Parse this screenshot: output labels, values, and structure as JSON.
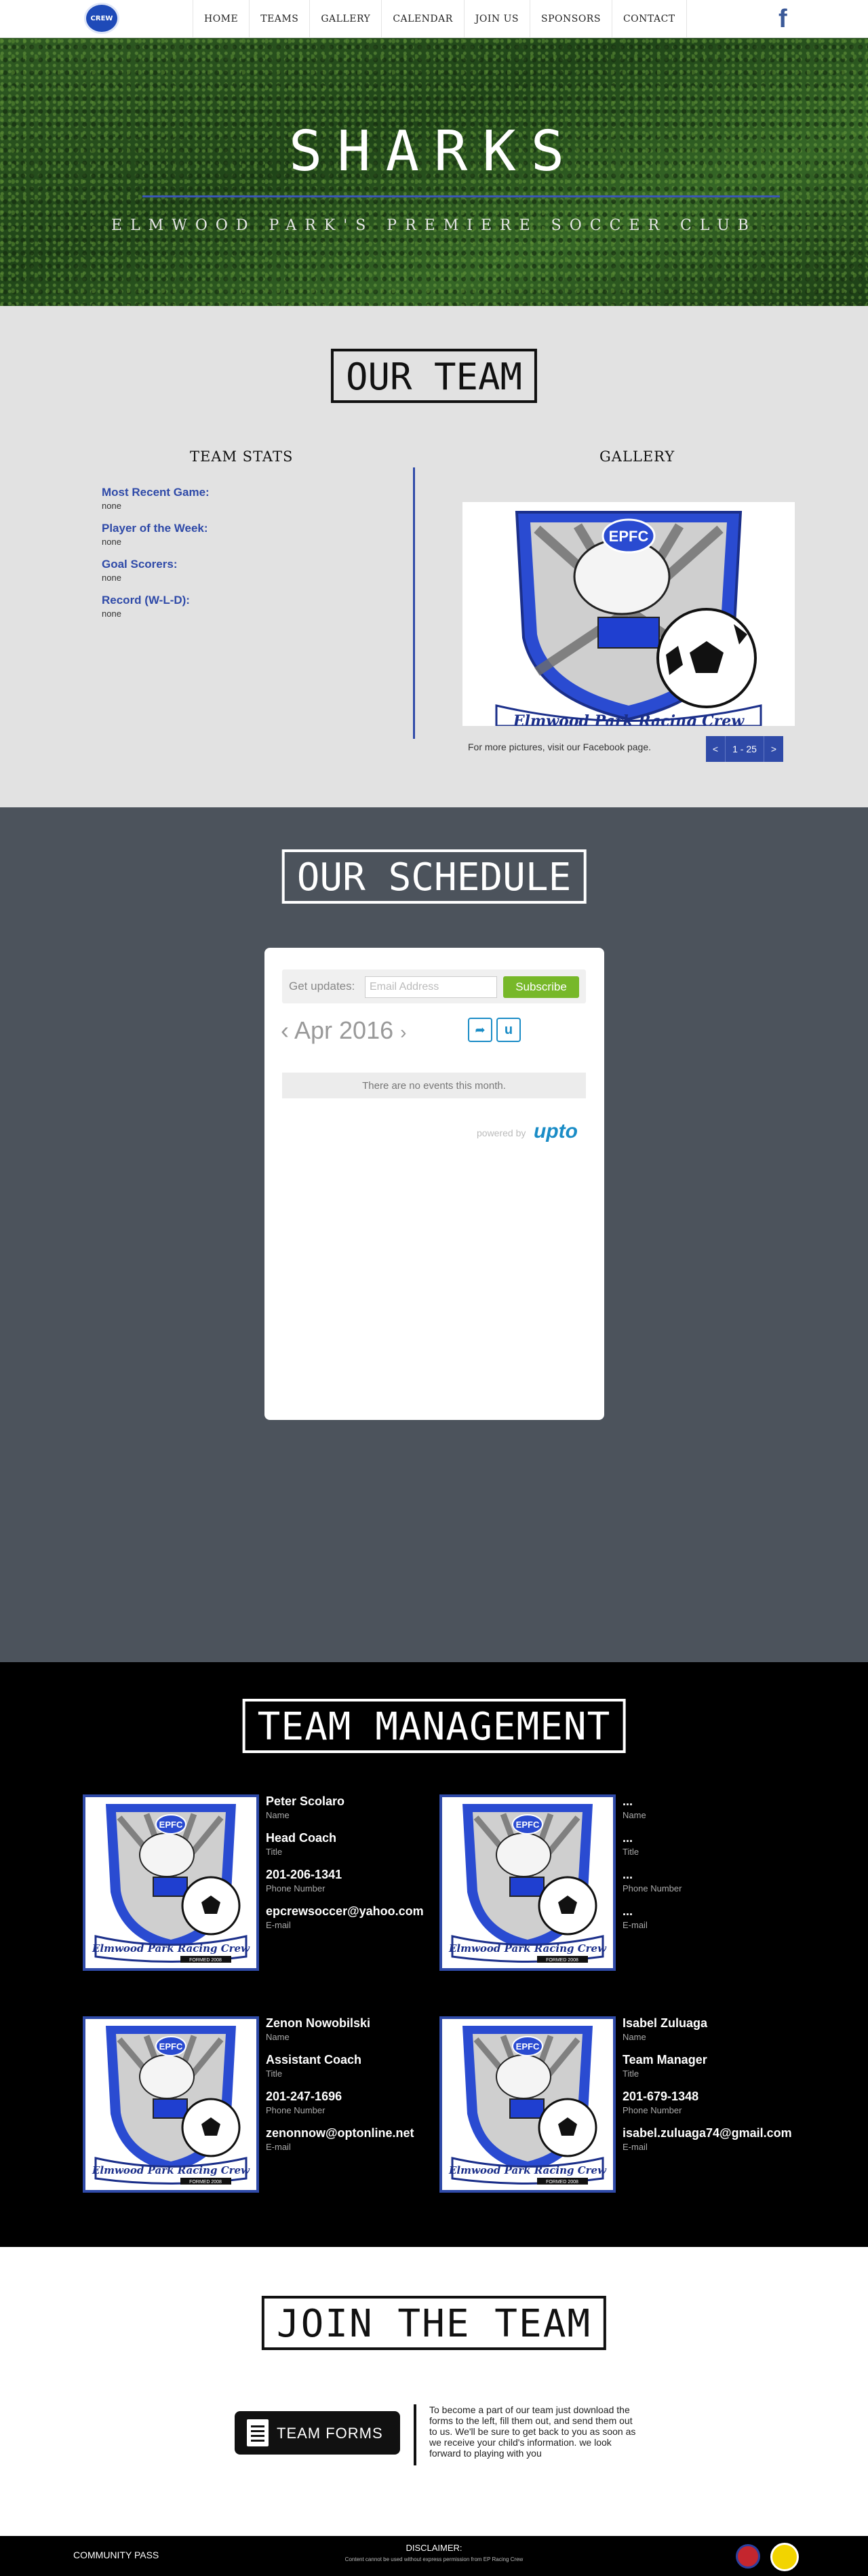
{
  "nav": {
    "logo_text": "CREW",
    "items": [
      {
        "label": "HOME"
      },
      {
        "label": "TEAMS"
      },
      {
        "label": "GALLERY"
      },
      {
        "label": "CALENDAR"
      },
      {
        "label": "JOIN US"
      },
      {
        "label": "SPONSORS"
      },
      {
        "label": "CONTACT"
      }
    ],
    "social_icon": "facebook-icon",
    "social_glyph": "f"
  },
  "hero": {
    "title": "SHARKS",
    "subtitle": "ELMWOOD PARK'S PREMIERE SOCCER CLUB"
  },
  "team": {
    "title": "OUR TEAM",
    "stats_heading": "TEAM STATS",
    "gallery_heading": "GALLERY",
    "stats": [
      {
        "label": "Most Recent Game:",
        "value": "none"
      },
      {
        "label": "Player of the Week:",
        "value": "none"
      },
      {
        "label": "Goal Scorers:",
        "value": "none"
      },
      {
        "label": "Record (W-L-D):",
        "value": "none"
      }
    ],
    "gallery_note": "For more pictures, visit our Facebook page.",
    "pager": {
      "prev": "<",
      "range": "1 - 25",
      "next": ">"
    },
    "crest_text": "EPFC",
    "crest_banner": "Elmwood Park Racing Crew"
  },
  "schedule": {
    "title": "OUR SCHEDULE",
    "updates_label": "Get updates:",
    "email_placeholder": "Email Address",
    "subscribe_label": "Subscribe",
    "month": "Apr 2016",
    "prev_glyph": "‹",
    "next_glyph": "›",
    "share_glyph": "➦",
    "u_glyph": "u",
    "empty_text": "There are no events this month.",
    "powered_by": "powered by",
    "brand": "upto"
  },
  "management": {
    "title": "TEAM MANAGEMENT",
    "crest_text": "EPFC",
    "crest_banner": "Elmwood Park Racing Crew",
    "crest_caption": "FORMED 2008",
    "labels": {
      "name": "Name",
      "title": "Title",
      "phone": "Phone Number",
      "email": "E-mail"
    },
    "people": [
      {
        "name": "Peter Scolaro",
        "title": "Head Coach",
        "phone": "201-206-1341",
        "email": "epcrewsoccer@yahoo.com"
      },
      {
        "name": "...",
        "title": "...",
        "phone": "...",
        "email": "..."
      },
      {
        "name": "Zenon Nowobilski",
        "title": "Assistant Coach",
        "phone": "201-247-1696",
        "email": "zenonnow@optonline.net"
      },
      {
        "name": "Isabel Zuluaga",
        "title": "Team Manager",
        "phone": "201-679-1348",
        "email": "isabel.zuluaga74@gmail.com"
      }
    ]
  },
  "join": {
    "title": "JOIN THE TEAM",
    "button_label": "TEAM FORMS",
    "text": "To become a part of our team just download the forms to the left, fill them out, and send them out to us. We'll be sure to get back to you as soon as we receive your child's information. we look forward to playing with you"
  },
  "footer": {
    "left": "COMMUNITY PASS",
    "disclaimer_title": "DISCLAIMER:",
    "disclaimer_text": "Content cannot be used without express permission from EP Racing Crew"
  },
  "colors": {
    "accent_blue": "#2f4aa8",
    "subscribe_green": "#77b829",
    "upto_blue": "#1a8cc6",
    "schedule_bg": "#4c535c",
    "team_bg": "#e2e2e2"
  }
}
